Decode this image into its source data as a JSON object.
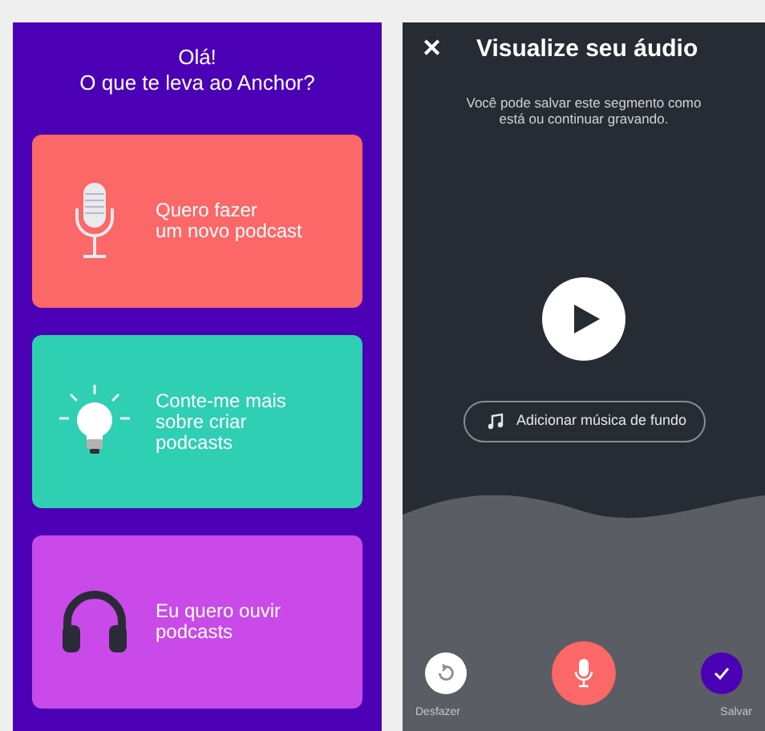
{
  "welcome_screen": {
    "title_lines": [
      "Olá!",
      "O que te leva ao Anchor?"
    ],
    "options": [
      {
        "kind": "microphone",
        "label_lines": [
          "Quero fazer",
          "um novo podcast"
        ],
        "color": "#fc6767"
      },
      {
        "kind": "lightbulb",
        "label_lines": [
          "Conte-me mais",
          "sobre criar",
          "podcasts"
        ],
        "color": "#2ecfb3"
      },
      {
        "kind": "headphones",
        "label_lines": [
          "Eu quero ouvir",
          "podcasts"
        ],
        "color": "#c94ae8"
      }
    ]
  },
  "preview_screen": {
    "close": "✕",
    "title": "Visualize seu áudio",
    "subtitle_lines": [
      "Você pode salvar este segmento como",
      "está ou continuar gravando."
    ],
    "music_button": "Adicionar música de fundo",
    "undo_label": "Desfazer",
    "save_label": "Salvar"
  }
}
